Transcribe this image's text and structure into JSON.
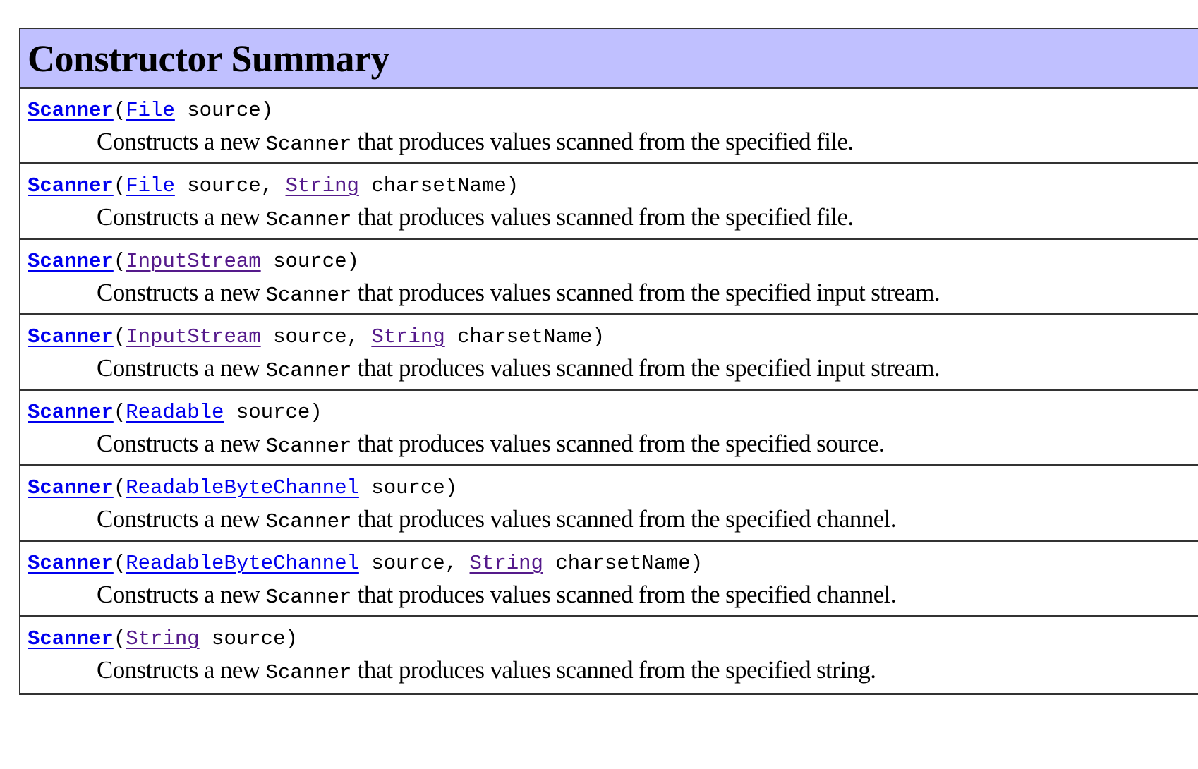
{
  "header": {
    "title": "Constructor Summary"
  },
  "rows": [
    {
      "ctor": "Scanner",
      "open": "(",
      "p1_type": "File",
      "p1_name": " source",
      "sep": ", ",
      "p2_type": "",
      "p2_name": "",
      "close": ")",
      "desc_pre": "Constructs a new ",
      "desc_code": "Scanner",
      "desc_post": " that produces values scanned from the specified file."
    },
    {
      "ctor": "Scanner",
      "open": "(",
      "p1_type": "File",
      "p1_name": " source",
      "sep": ", ",
      "p2_type": "String",
      "p2_name": " charsetName",
      "close": ")",
      "desc_pre": "Constructs a new ",
      "desc_code": "Scanner",
      "desc_post": " that produces values scanned from the specified file."
    },
    {
      "ctor": "Scanner",
      "open": "(",
      "p1_type": "InputStream",
      "p1_name": " source",
      "sep": ", ",
      "p2_type": "",
      "p2_name": "",
      "close": ")",
      "desc_pre": "Constructs a new ",
      "desc_code": "Scanner",
      "desc_post": " that produces values scanned from the specified input stream."
    },
    {
      "ctor": "Scanner",
      "open": "(",
      "p1_type": "InputStream",
      "p1_name": " source",
      "sep": ", ",
      "p2_type": "String",
      "p2_name": " charsetName",
      "close": ")",
      "desc_pre": "Constructs a new ",
      "desc_code": "Scanner",
      "desc_post": " that produces values scanned from the specified input stream."
    },
    {
      "ctor": "Scanner",
      "open": "(",
      "p1_type": "Readable",
      "p1_name": " source",
      "sep": ", ",
      "p2_type": "",
      "p2_name": "",
      "close": ")",
      "desc_pre": "Constructs a new ",
      "desc_code": "Scanner",
      "desc_post": " that produces values scanned from the specified source."
    },
    {
      "ctor": "Scanner",
      "open": "(",
      "p1_type": "ReadableByteChannel",
      "p1_name": " source",
      "sep": ", ",
      "p2_type": "",
      "p2_name": "",
      "close": ")",
      "desc_pre": "Constructs a new ",
      "desc_code": "Scanner",
      "desc_post": " that produces values scanned from the specified channel."
    },
    {
      "ctor": "Scanner",
      "open": "(",
      "p1_type": "ReadableByteChannel",
      "p1_name": " source",
      "sep": ", ",
      "p2_type": "String",
      "p2_name": " charsetName",
      "close": ")",
      "desc_pre": "Constructs a new ",
      "desc_code": "Scanner",
      "desc_post": " that produces values scanned from the specified channel."
    },
    {
      "ctor": "Scanner",
      "open": "(",
      "p1_type": "String",
      "p1_name": " source",
      "sep": ", ",
      "p2_type": "",
      "p2_name": "",
      "close": ")",
      "desc_pre": "Constructs a new ",
      "desc_code": "Scanner",
      "desc_post": " that produces values scanned from the specified string."
    }
  ],
  "colors": {
    "header_bg": "#c0c0ff",
    "link": "#0000ee",
    "visited_link": "#551a8b",
    "border": "#333333"
  }
}
